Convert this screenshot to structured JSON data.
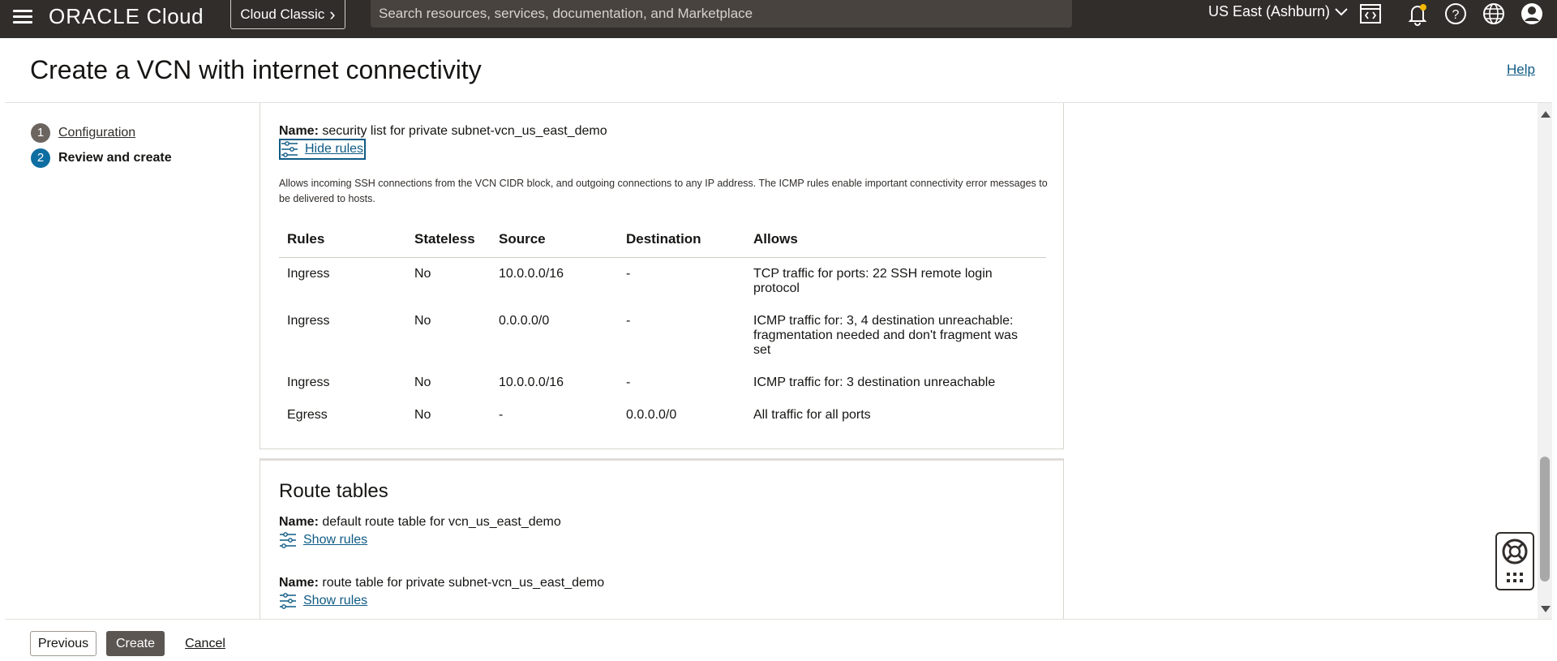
{
  "topbar": {
    "logo_brand": "ORACLE",
    "logo_product": "Cloud",
    "classic_button": "Cloud Classic",
    "classic_chevron": "›",
    "search_placeholder": "Search resources, services, documentation, and Marketplace",
    "region": "US East (Ashburn)",
    "icons": [
      "menu-icon",
      "code-editor-icon",
      "notifications-icon",
      "help-icon",
      "language-globe-icon",
      "user-profile-icon"
    ]
  },
  "header": {
    "title": "Create a VCN with internet connectivity",
    "help_link": "Help"
  },
  "steps": [
    {
      "number": "1",
      "label": "Configuration"
    },
    {
      "number": "2",
      "label": "Review and create"
    }
  ],
  "security_list": {
    "name_label": "Name:",
    "name_value": "security list for private subnet-vcn_us_east_demo",
    "toggle_label": "Hide rules",
    "description": "Allows incoming SSH connections from the VCN CIDR block, and outgoing connections to any IP address. The ICMP rules enable important connectivity error messages to be delivered to hosts.",
    "columns": [
      "Rules",
      "Stateless",
      "Source",
      "Destination",
      "Allows"
    ],
    "rows": [
      {
        "rule": "Ingress",
        "stateless": "No",
        "source": "10.0.0.0/16",
        "destination": "-",
        "allows": "TCP traffic for ports: 22 SSH remote login protocol"
      },
      {
        "rule": "Ingress",
        "stateless": "No",
        "source": "0.0.0.0/0",
        "destination": "-",
        "allows": "ICMP traffic for: 3, 4 destination unreachable: fragmentation needed and don't fragment was set"
      },
      {
        "rule": "Ingress",
        "stateless": "No",
        "source": "10.0.0.0/16",
        "destination": "-",
        "allows": "ICMP traffic for: 3 destination unreachable"
      },
      {
        "rule": "Egress",
        "stateless": "No",
        "source": "-",
        "destination": "0.0.0.0/0",
        "allows": "All traffic for all ports"
      }
    ]
  },
  "route_tables": {
    "title": "Route tables",
    "tables": [
      {
        "name_label": "Name:",
        "name_value": "default route table for vcn_us_east_demo",
        "toggle_label": "Show rules"
      },
      {
        "name_label": "Name:",
        "name_value": "route table for private subnet-vcn_us_east_demo",
        "toggle_label": "Show rules"
      }
    ]
  },
  "footer": {
    "previous": "Previous",
    "create": "Create",
    "cancel": "Cancel"
  },
  "colors": {
    "topbar": "#312d2a",
    "link": "#0f5b85",
    "active_step": "#0f6ea1",
    "primary_button": "#5b5652"
  }
}
